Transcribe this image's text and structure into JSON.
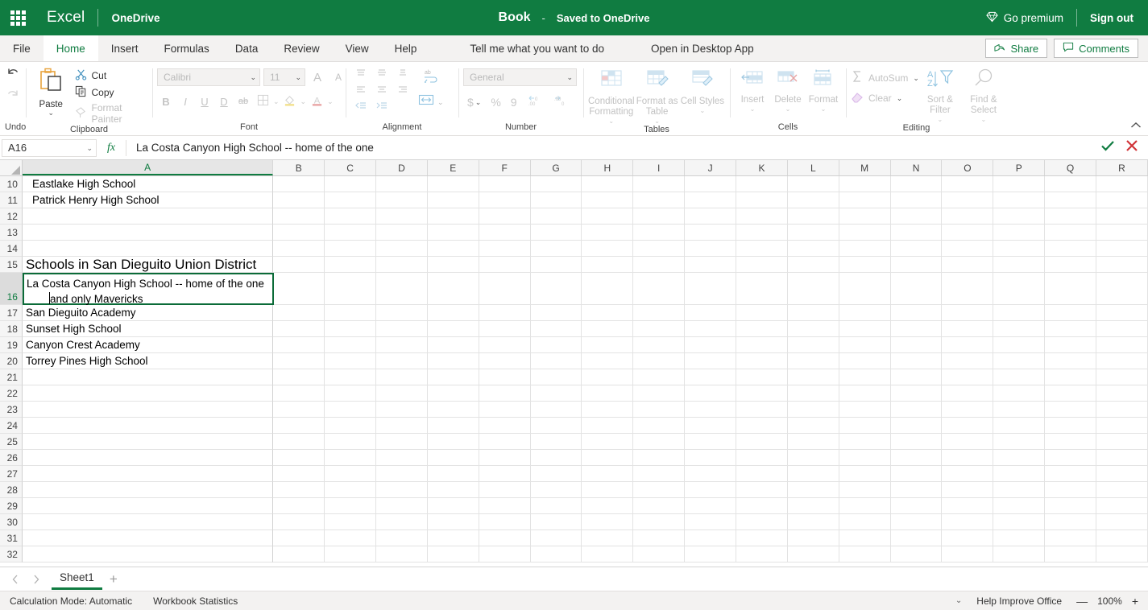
{
  "titlebar": {
    "waffle_icon": "app-launcher-icon",
    "app_name": "Excel",
    "location": "OneDrive",
    "doc_title": "Book",
    "doc_dash": "-",
    "doc_status": "Saved to OneDrive",
    "premium_icon": "diamond-icon",
    "go_premium": "Go premium",
    "sign_out": "Sign out",
    "brand_color": "#107c41"
  },
  "ribbon_tabs": {
    "items": [
      {
        "label": "File",
        "active": false
      },
      {
        "label": "Home",
        "active": true
      },
      {
        "label": "Insert",
        "active": false
      },
      {
        "label": "Formulas",
        "active": false
      },
      {
        "label": "Data",
        "active": false
      },
      {
        "label": "Review",
        "active": false
      },
      {
        "label": "View",
        "active": false
      },
      {
        "label": "Help",
        "active": false
      }
    ],
    "tell_me": "Tell me what you want to do",
    "open_desktop": "Open in Desktop App",
    "share": "Share",
    "share_icon": "share-icon",
    "comments": "Comments",
    "comments_icon": "comment-icon"
  },
  "ribbon": {
    "undo": {
      "group_label": "Undo",
      "undo_icon": "undo-arrow-icon",
      "redo_icon": "redo-arrow-icon"
    },
    "clipboard": {
      "group_label": "Clipboard",
      "paste_label": "Paste",
      "cut_label": "Cut",
      "cut_icon": "scissors-icon",
      "copy_label": "Copy",
      "copy_icon": "copy-icon",
      "format_painter_label": "Format Painter",
      "format_painter_icon": "paintbrush-icon",
      "paste_icon": "clipboard-icon"
    },
    "font": {
      "group_label": "Font",
      "font_family_value": "Calibri",
      "font_size_value": "11",
      "grow_font": "A",
      "shrink_font": "A",
      "bold": "B",
      "italic": "I",
      "underline": "U",
      "double_underline": "D",
      "strikethrough": "ab",
      "borders_icon": "borders-icon",
      "fill_color_icon": "fill-color-icon",
      "font_color_icon": "font-color-icon"
    },
    "alignment": {
      "group_label": "Alignment",
      "wrap_text_icon": "wrap-text-icon",
      "merge_icon": "merge-cells-icon"
    },
    "number": {
      "group_label": "Number",
      "format_value": "General",
      "currency": "$",
      "percent": "%",
      "comma": "9",
      "increase_decimal": ".00",
      "decrease_decimal": ".00"
    },
    "tables": {
      "group_label": "Tables",
      "items": [
        {
          "label": "Conditional Formatting",
          "icon": "conditional-formatting-icon"
        },
        {
          "label": "Format as Table",
          "icon": "format-as-table-icon"
        },
        {
          "label": "Cell Styles",
          "icon": "cell-styles-icon"
        }
      ]
    },
    "cells": {
      "group_label": "Cells",
      "items": [
        {
          "label": "Insert",
          "icon": "insert-cells-icon"
        },
        {
          "label": "Delete",
          "icon": "delete-cells-icon"
        },
        {
          "label": "Format",
          "icon": "format-cells-icon"
        }
      ]
    },
    "editing": {
      "group_label": "Editing",
      "autosum": "AutoSum",
      "autosum_icon": "sigma-icon",
      "clear": "Clear",
      "clear_icon": "eraser-icon",
      "sort_filter": "Sort & Filter",
      "sort_filter_icon": "sort-filter-icon",
      "find_select": "Find & Select",
      "find_select_icon": "magnifier-icon"
    },
    "collapse_icon": "chevron-up-icon"
  },
  "formula_bar": {
    "name_box_value": "A16",
    "name_box_caret": "chevron-down-icon",
    "fx_label": "fx",
    "formula_value": "La Costa Canyon High School -- home of the one",
    "accept_icon": "check-icon",
    "cancel_icon": "close-icon",
    "accept_color": "#107c41",
    "cancel_color": "#d13438"
  },
  "grid": {
    "columns": [
      "A",
      "B",
      "C",
      "D",
      "E",
      "F",
      "G",
      "H",
      "I",
      "J",
      "K",
      "L",
      "M",
      "N",
      "O",
      "P",
      "Q",
      "R"
    ],
    "selected_column": "A",
    "selected_row": 16,
    "rows": [
      {
        "num": 10,
        "a": "Eastlake High School",
        "style": "indent"
      },
      {
        "num": 11,
        "a": "Patrick Henry High School",
        "style": "indent"
      },
      {
        "num": 12,
        "a": "",
        "style": ""
      },
      {
        "num": 13,
        "a": "",
        "style": ""
      },
      {
        "num": 14,
        "a": "",
        "style": ""
      },
      {
        "num": 15,
        "a": "Schools in San Dieguito Union District",
        "style": "heading"
      },
      {
        "num": 16,
        "a": "",
        "style": "editing"
      },
      {
        "num": 17,
        "a": "San Dieguito Academy",
        "style": ""
      },
      {
        "num": 18,
        "a": "Sunset High School",
        "style": ""
      },
      {
        "num": 19,
        "a": "Canyon Crest Academy",
        "style": ""
      },
      {
        "num": 20,
        "a": "Torrey Pines High School",
        "style": ""
      },
      {
        "num": 21,
        "a": "",
        "style": ""
      },
      {
        "num": 22,
        "a": "",
        "style": ""
      },
      {
        "num": 23,
        "a": "",
        "style": ""
      },
      {
        "num": 24,
        "a": "",
        "style": ""
      },
      {
        "num": 25,
        "a": "",
        "style": ""
      },
      {
        "num": 26,
        "a": "",
        "style": ""
      },
      {
        "num": 27,
        "a": "",
        "style": ""
      },
      {
        "num": 28,
        "a": "",
        "style": ""
      },
      {
        "num": 29,
        "a": "",
        "style": ""
      },
      {
        "num": 30,
        "a": "",
        "style": ""
      },
      {
        "num": 31,
        "a": "",
        "style": ""
      },
      {
        "num": 32,
        "a": "",
        "style": ""
      }
    ],
    "editing_cell": {
      "ref": "A16",
      "line1": "La Costa Canyon High School -- home of the one",
      "line2": "and only Mavericks",
      "border_color": "#0b6b38"
    }
  },
  "sheetbar": {
    "prev_icon": "chevron-left-icon",
    "next_icon": "chevron-right-icon",
    "tabs": [
      {
        "label": "Sheet1",
        "active": true
      }
    ],
    "add_icon": "plus-icon"
  },
  "statusbar": {
    "calculation_mode": "Calculation Mode: Automatic",
    "workbook_statistics": "Workbook Statistics",
    "options_caret": "chevron-down-icon",
    "help_improve": "Help Improve Office",
    "zoom_out": "—",
    "zoom_value": "100%",
    "zoom_in": "+"
  }
}
